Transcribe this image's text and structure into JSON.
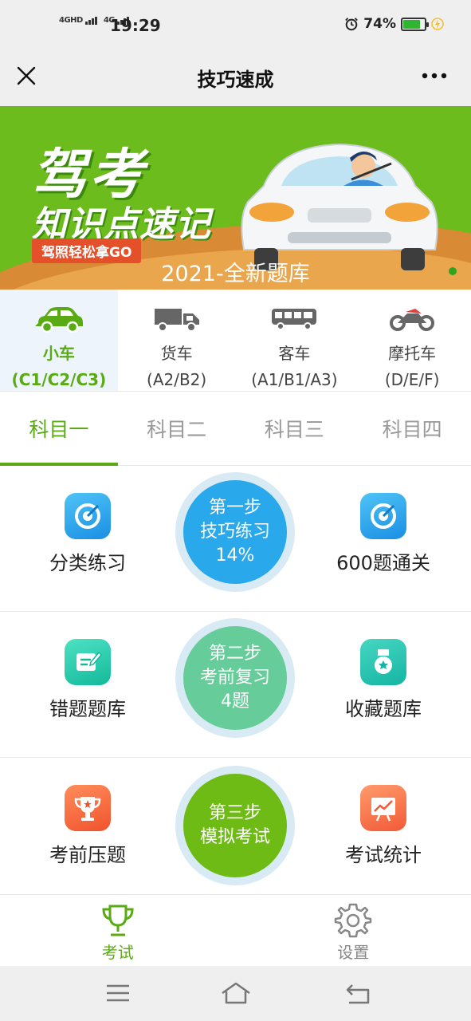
{
  "status_bar": {
    "signal1": "4GHD",
    "signal2": "4G",
    "time": "19:29",
    "battery_text": "74%",
    "battery_level": 0.74
  },
  "header": {
    "title": "技巧速成"
  },
  "banner": {
    "headline": "驾考",
    "subheadline": "知识点速记",
    "tag": "驾照轻松拿GO",
    "caption": "2021-全新题库"
  },
  "vehicles": [
    {
      "name": "小车",
      "code": "(C1/C2/C3)",
      "icon": "car-icon"
    },
    {
      "name": "货车",
      "code": "(A2/B2)",
      "icon": "truck-icon"
    },
    {
      "name": "客车",
      "code": "(A1/B1/A3)",
      "icon": "bus-icon"
    },
    {
      "name": "摩托车",
      "code": "(D/E/F)",
      "icon": "motorcycle-icon"
    }
  ],
  "subjects": [
    "科目一",
    "科目二",
    "科目三",
    "科目四"
  ],
  "rows": [
    {
      "left": {
        "label": "分类练习",
        "icon": "target-icon"
      },
      "step": {
        "line1": "第一步",
        "line2": "技巧练习",
        "line3": "14%"
      },
      "right": {
        "label": "600题通关",
        "icon": "target-icon"
      }
    },
    {
      "left": {
        "label": "错题题库",
        "icon": "edit-note-icon"
      },
      "step": {
        "line1": "第二步",
        "line2": "考前复习",
        "line3": "4题"
      },
      "right": {
        "label": "收藏题库",
        "icon": "medal-icon"
      }
    },
    {
      "left": {
        "label": "考前压题",
        "icon": "trophy-icon"
      },
      "step": {
        "line1": "第三步",
        "line2": "模拟考试"
      },
      "right": {
        "label": "考试统计",
        "icon": "chart-icon"
      }
    }
  ],
  "bottom_nav": [
    {
      "label": "考试",
      "icon": "trophy-icon"
    },
    {
      "label": "设置",
      "icon": "gear-icon"
    }
  ],
  "colors": {
    "accent": "#5aab13",
    "step1": "#2aa8ec",
    "step2": "#66cc9a",
    "step3": "#6fbb16"
  }
}
